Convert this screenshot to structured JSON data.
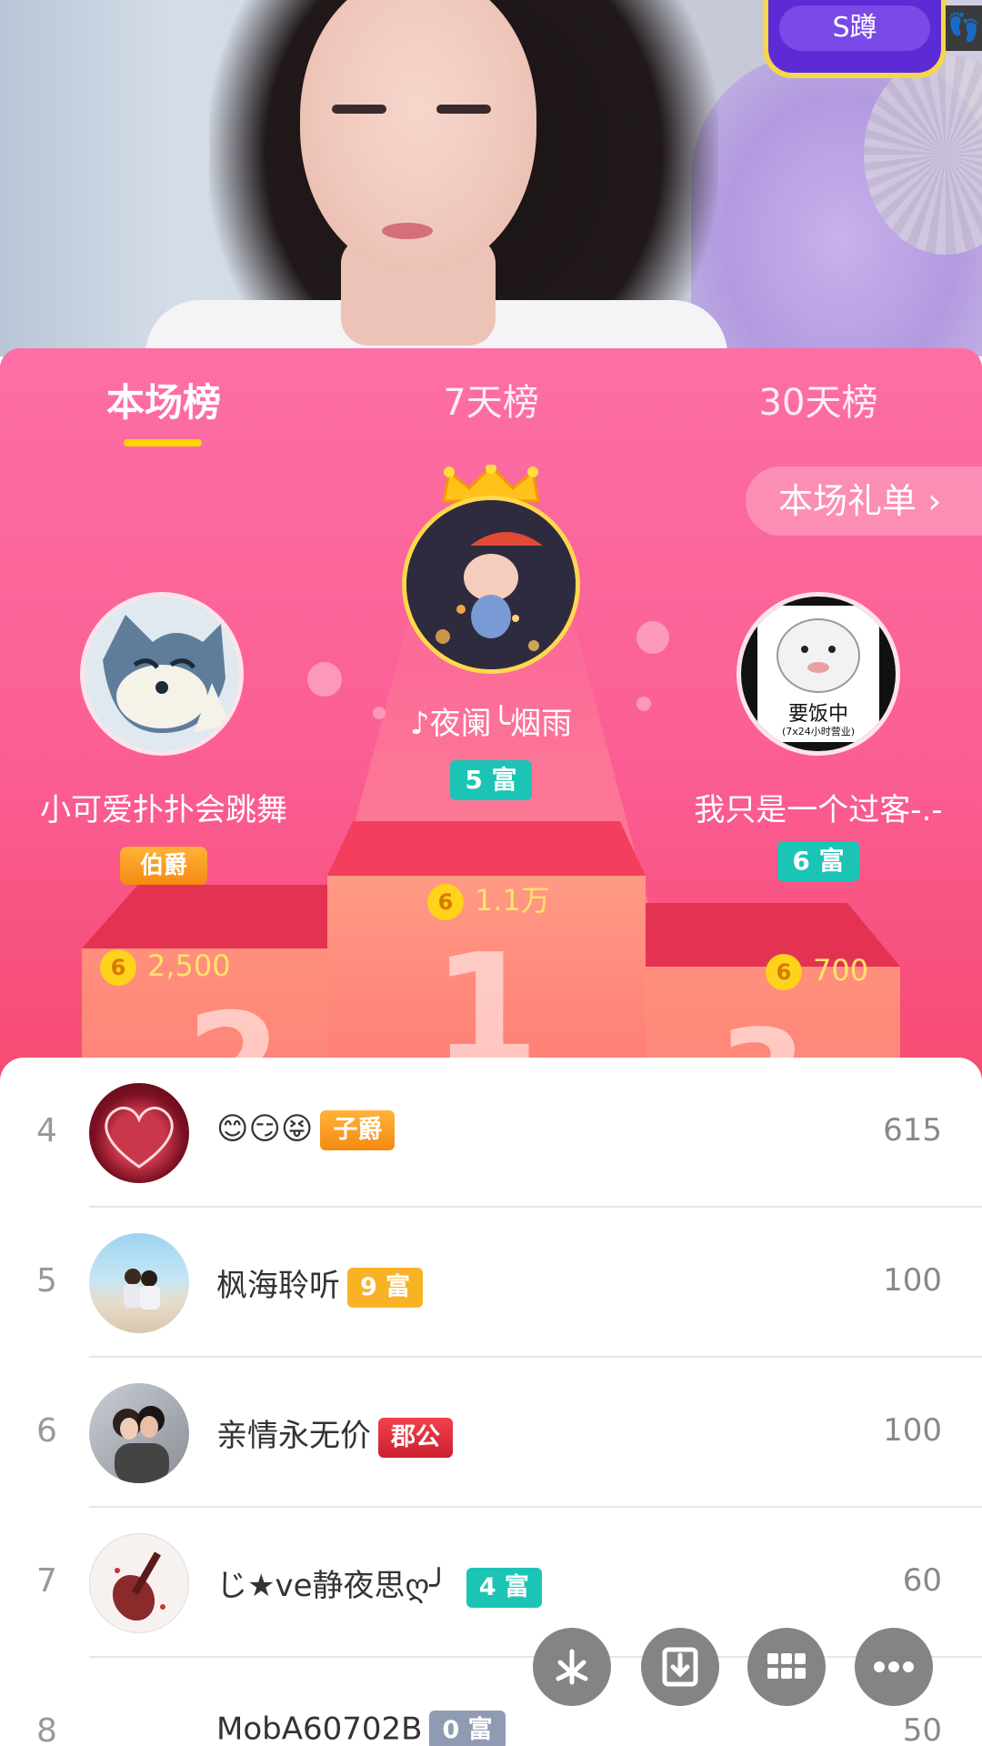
{
  "video": {
    "badge_label": "S蹲",
    "foot_icon": "footprint-icon"
  },
  "tabs": [
    "本场榜",
    "7天榜",
    "30天榜"
  ],
  "gift_button": "本场礼单 ›",
  "podium": {
    "first": {
      "name": "♪夜阑╰烟雨",
      "wealth": "5 富",
      "score": "1.1万",
      "rank": "1"
    },
    "second": {
      "name": "小可爱扑扑会跳舞",
      "noble": "伯爵",
      "score": "2,500",
      "rank": "2"
    },
    "third": {
      "name": "我只是一个过客-.-",
      "wealth": "6 富",
      "score": "700",
      "rank": "3",
      "avatar_text": "要饭中",
      "avatar_sub": "(7x24小时营业)"
    }
  },
  "coin_glyph": "6",
  "list": [
    {
      "rank": "4",
      "name": "😊😏😝",
      "tag": "子爵",
      "tag_type": "noble-orange",
      "value": "615"
    },
    {
      "rank": "5",
      "name": "枫海聆听",
      "tag": "9 富",
      "tag_type": "wealth-orange",
      "value": "100"
    },
    {
      "rank": "6",
      "name": "亲情永无价",
      "tag": "郡公",
      "tag_type": "noble-red",
      "value": "100"
    },
    {
      "rank": "7",
      "name": "じ★ve静夜思ღ╯",
      "tag": "4 富",
      "tag_type": "wealth-teal",
      "value": "60"
    },
    {
      "rank": "8",
      "name": "MobA60702B",
      "tag": "0 富",
      "tag_type": "wealth-gray",
      "value": "50"
    }
  ],
  "colors": {
    "accent_pink": "#fb6fa4",
    "gold": "#ffd84d",
    "teal": "#1bc4b5"
  }
}
